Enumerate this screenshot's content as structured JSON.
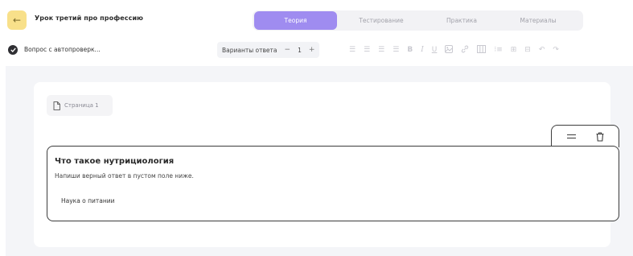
{
  "header": {
    "lesson_title": "Урок третий про профессию",
    "tabs": [
      {
        "label": "Теория",
        "active": true
      },
      {
        "label": "Тестирование",
        "active": false
      },
      {
        "label": "Практика",
        "active": false
      },
      {
        "label": "Материалы",
        "active": false
      }
    ]
  },
  "toolbar": {
    "question_type": "Вопрос с автопроверк...",
    "answer_options_label": "Варианты ответа",
    "decrement": "−",
    "answer_count": "1",
    "increment": "+"
  },
  "page_chip": {
    "label": "Страница 1"
  },
  "question": {
    "title": "Что такое нутрициология",
    "hint": "Напиши верный ответ в пустом поле ниже.",
    "answer": "Наука о питании"
  },
  "colors": {
    "accent": "#9f8cf0",
    "back_button": "#f8e08a",
    "content_bg": "#f4f5f8"
  }
}
